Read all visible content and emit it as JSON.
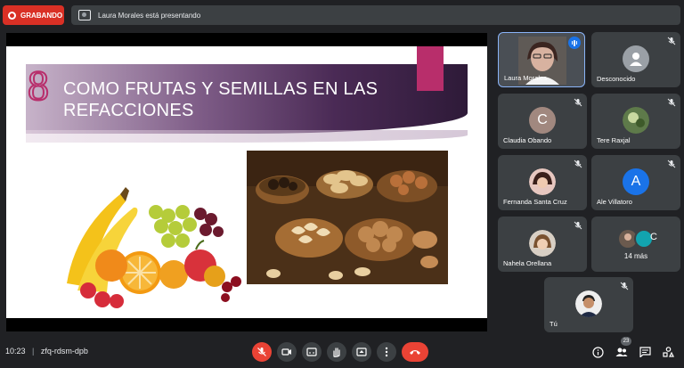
{
  "top": {
    "recording_label": "GRABANDO",
    "presenting_text": "Laura Morales está presentando"
  },
  "slide": {
    "number": "8",
    "title": "COMO FRUTAS Y SEMILLAS EN LAS REFACCIONES",
    "accent_color": "#b82e6b"
  },
  "participants": [
    {
      "name": "Laura Morales",
      "speaking": true
    },
    {
      "name": "Desconocido",
      "muted": true
    },
    {
      "name": "Claudia Obando",
      "initial": "C",
      "muted": true
    },
    {
      "name": "Tere Raxjal",
      "muted": true
    },
    {
      "name": "Fernanda Santa Cruz",
      "muted": true
    },
    {
      "name": "Ale Villatoro",
      "initial": "A",
      "muted": true
    },
    {
      "name": "Nahela Orellana",
      "muted": true
    },
    {
      "name": "14 más",
      "initial": "C"
    },
    {
      "name": "Tú",
      "muted": true
    }
  ],
  "bottom": {
    "time": "10:23",
    "separator": "|",
    "meeting_code": "zfq-rdsm-dpb",
    "participants_count": "23"
  },
  "icons": {
    "mic": "mic-off-icon",
    "camera": "camera-icon",
    "captions": "captions-icon",
    "hand": "raise-hand-icon",
    "present": "present-screen-icon",
    "more": "more-options-icon",
    "hangup": "hang-up-icon",
    "info": "info-icon",
    "people": "people-icon",
    "chat": "chat-icon",
    "activities": "activities-icon"
  },
  "colors": {
    "background": "#202124",
    "tile": "#3c4043",
    "danger": "#ea4335",
    "recording": "#d93025",
    "accent_blue": "#1a73e8"
  }
}
